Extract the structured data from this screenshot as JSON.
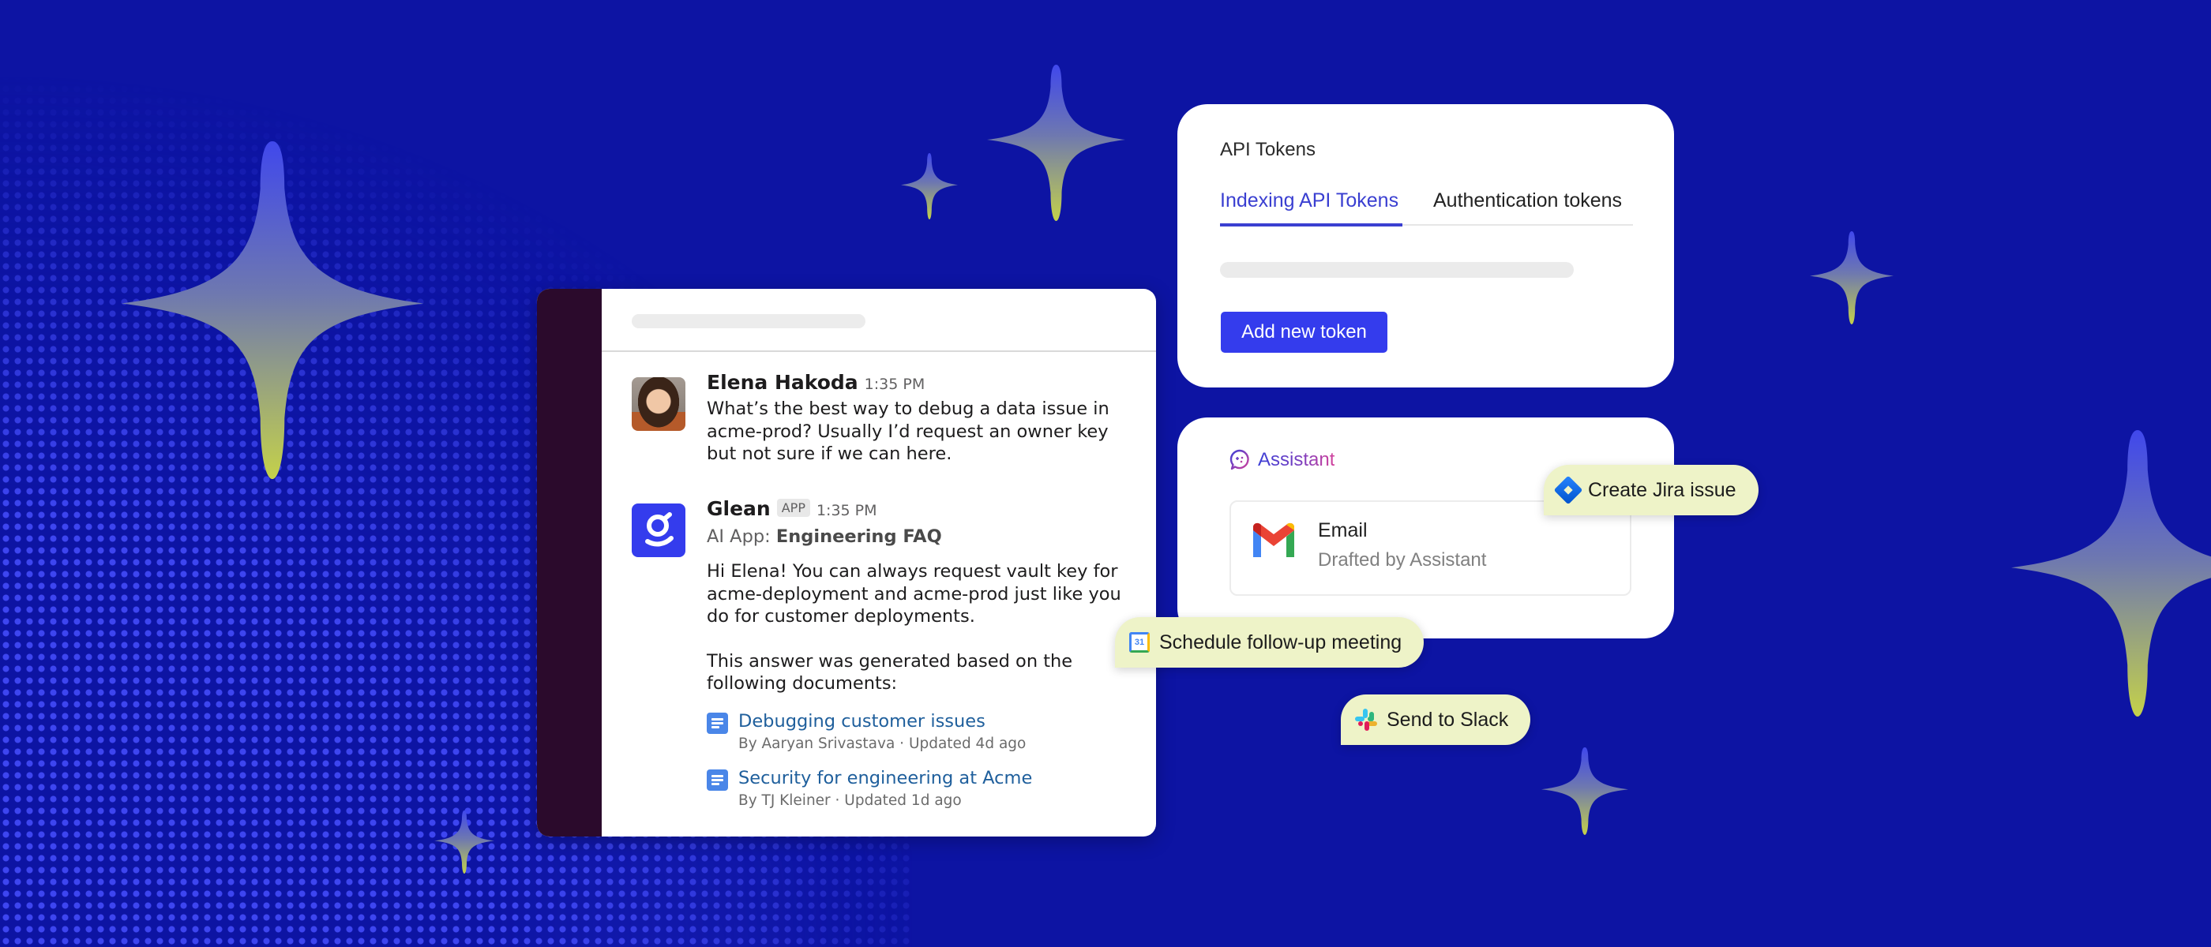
{
  "colors": {
    "background": "#0d14a3",
    "accent": "#343ced",
    "slack_sidebar": "#2b0a2c",
    "pill_bg": "#eef3c8",
    "link": "#1f5f9c"
  },
  "slack": {
    "messages": [
      {
        "sender": "Elena Hakoda",
        "time": "1:35 PM",
        "avatar": "user-photo",
        "text": "What’s the best way to debug a data issue in\nacme-prod? Usually I’d request an owner key\nbut not sure if we can here."
      },
      {
        "sender": "Glean",
        "badge": "APP",
        "time": "1:35 PM",
        "avatar": "glean-logo-icon",
        "app_prefix": "AI App: ",
        "app_name": "Engineering FAQ",
        "text": "Hi Elena! You can always request vault key for\nacme-deployment and acme-prod just like you\ndo for customer deployments.",
        "text2": "This answer was generated based on the\nfollowing documents:",
        "documents": [
          {
            "title": "Debugging customer issues",
            "meta": "By Aaryan Srivastava · Updated 4d ago",
            "icon": "google-doc-icon"
          },
          {
            "title": "Security for engineering at Acme",
            "meta": "By TJ Kleiner · Updated 1d ago",
            "icon": "google-doc-icon"
          }
        ]
      }
    ]
  },
  "api_tokens": {
    "title": "API Tokens",
    "tabs": [
      {
        "label": "Indexing API Tokens",
        "active": true
      },
      {
        "label": "Authentication tokens",
        "active": false
      }
    ],
    "add_button": "Add new token"
  },
  "assistant": {
    "label": "Assistant",
    "icon": "assistant-chat-icon",
    "email": {
      "icon": "gmail-icon",
      "title": "Email",
      "subtitle": "Drafted by Assistant"
    }
  },
  "actions": [
    {
      "label": "Create Jira issue",
      "icon": "jira-icon"
    },
    {
      "label": "Schedule follow-up meeting",
      "icon": "google-calendar-icon",
      "icon_text": "31"
    },
    {
      "label": "Send to Slack",
      "icon": "slack-icon"
    }
  ]
}
